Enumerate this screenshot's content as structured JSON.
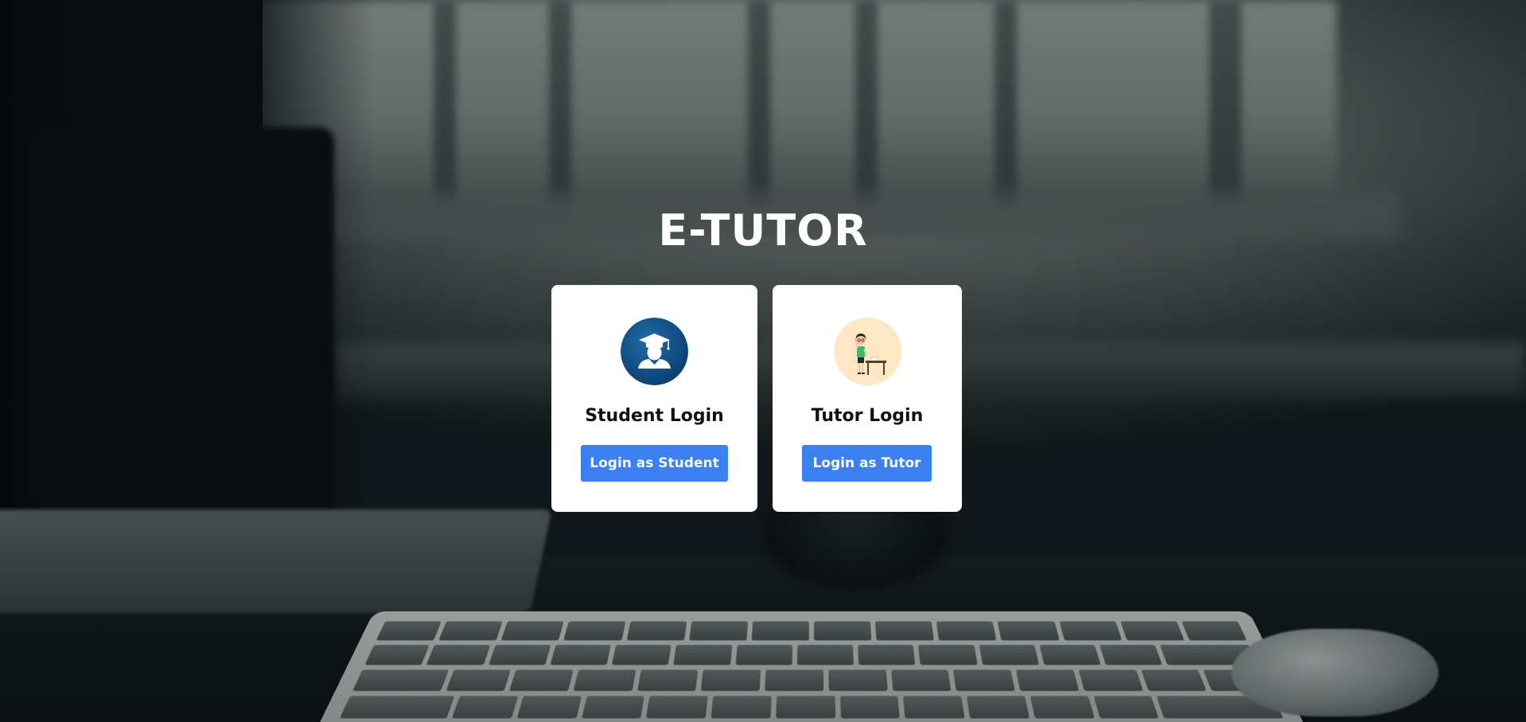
{
  "app": {
    "title": "E-TUTOR"
  },
  "cards": [
    {
      "id": "student",
      "heading": "Student Login",
      "button_label": "Login as Student",
      "icon": "graduate-icon",
      "icon_bg": "#0e4f86"
    },
    {
      "id": "tutor",
      "heading": "Tutor Login",
      "button_label": "Login as Tutor",
      "icon": "teacher-icon",
      "icon_bg": "#fde7c4"
    }
  ],
  "theme": {
    "button_color": "#3b7ff0",
    "card_bg": "#ffffff",
    "title_color": "#ffffff"
  }
}
